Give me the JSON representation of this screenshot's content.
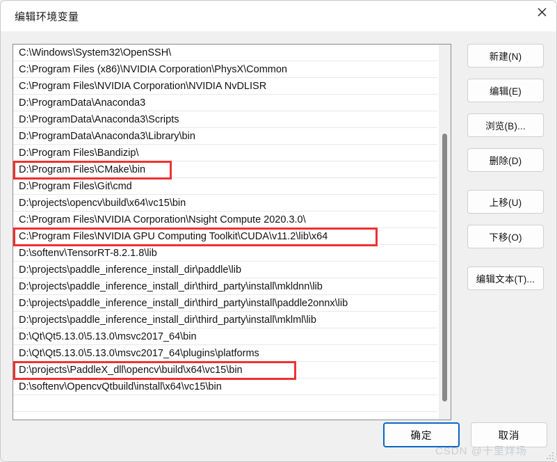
{
  "window": {
    "title": "编辑环境变量",
    "close_icon": "close-icon"
  },
  "list": {
    "rows": [
      "C:\\Windows\\System32\\OpenSSH\\",
      "C:\\Program Files (x86)\\NVIDIA Corporation\\PhysX\\Common",
      "C:\\Program Files\\NVIDIA Corporation\\NVIDIA NvDLISR",
      "D:\\ProgramData\\Anaconda3",
      "D:\\ProgramData\\Anaconda3\\Scripts",
      "D:\\ProgramData\\Anaconda3\\Library\\bin",
      "D:\\Program Files\\Bandizip\\",
      "D:\\Program Files\\CMake\\bin",
      "D:\\Program Files\\Git\\cmd",
      "D:\\projects\\opencv\\build\\x64\\vc15\\bin",
      "C:\\Program Files\\NVIDIA Corporation\\Nsight Compute 2020.3.0\\",
      "C:\\Program Files\\NVIDIA GPU Computing Toolkit\\CUDA\\v11.2\\lib\\x64",
      "D:\\softenv\\TensorRT-8.2.1.8\\lib",
      "D:\\projects\\paddle_inference_install_dir\\paddle\\lib",
      "D:\\projects\\paddle_inference_install_dir\\third_party\\install\\mkldnn\\lib",
      "D:\\projects\\paddle_inference_install_dir\\third_party\\install\\paddle2onnx\\lib",
      "D:\\projects\\paddle_inference_install_dir\\third_party\\install\\mklml\\lib",
      "D:\\Qt\\Qt5.13.0\\5.13.0\\msvc2017_64\\bin",
      "D:\\Qt\\Qt5.13.0\\5.13.0\\msvc2017_64\\plugins\\platforms",
      "D:\\projects\\PaddleX_dll\\opencv\\build\\x64\\vc15\\bin",
      "D:\\softenv\\OpencvQtbuild\\install\\x64\\vc15\\bin",
      ""
    ],
    "highlight_color": "#f03030",
    "highlighted_rows": [
      7,
      11,
      19
    ],
    "highlight_widths": [
      228,
      524,
      407
    ]
  },
  "side_buttons": [
    {
      "label": "新建(N)"
    },
    {
      "label": "编辑(E)"
    },
    {
      "label": "浏览(B)..."
    },
    {
      "label": "删除(D)"
    },
    {
      "label": "上移(U)"
    },
    {
      "label": "下移(O)"
    },
    {
      "label": "编辑文本(T)..."
    }
  ],
  "bottom_buttons": {
    "ok_label": "确定",
    "cancel_label": "取消",
    "accent_color": "#0a66c2"
  },
  "watermark": {
    "text": "CSDN @十里烊场"
  }
}
